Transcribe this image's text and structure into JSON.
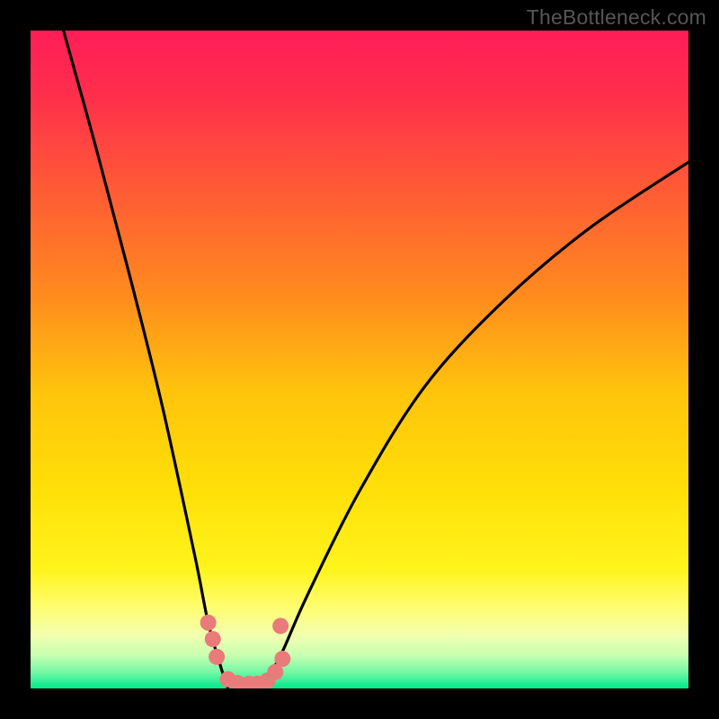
{
  "watermark": "TheBottleneck.com",
  "chart_data": {
    "type": "line",
    "title": "",
    "xlabel": "",
    "ylabel": "",
    "xlim": [
      0,
      100
    ],
    "ylim": [
      0,
      100
    ],
    "background_gradient_stops": [
      {
        "offset": 0.0,
        "color": "#ff1d57"
      },
      {
        "offset": 0.1,
        "color": "#ff2f4b"
      },
      {
        "offset": 0.25,
        "color": "#ff5d34"
      },
      {
        "offset": 0.4,
        "color": "#ff8a1e"
      },
      {
        "offset": 0.55,
        "color": "#ffc40c"
      },
      {
        "offset": 0.7,
        "color": "#ffe008"
      },
      {
        "offset": 0.82,
        "color": "#fff41d"
      },
      {
        "offset": 0.88,
        "color": "#fffd75"
      },
      {
        "offset": 0.92,
        "color": "#f1ffb0"
      },
      {
        "offset": 0.95,
        "color": "#c8ffb0"
      },
      {
        "offset": 0.975,
        "color": "#74f8a6"
      },
      {
        "offset": 1.0,
        "color": "#00e98a"
      }
    ],
    "series": [
      {
        "name": "left-descent",
        "type": "curve",
        "x": [
          5,
          10,
          15,
          20,
          25,
          27,
          29,
          30
        ],
        "y": [
          100,
          82,
          63,
          43,
          20,
          10,
          3,
          0
        ]
      },
      {
        "name": "right-ascent",
        "type": "curve",
        "x": [
          35,
          38,
          42,
          50,
          60,
          72,
          85,
          100
        ],
        "y": [
          0,
          5,
          14,
          30,
          46,
          59,
          70,
          80
        ]
      },
      {
        "name": "markers",
        "type": "scatter",
        "color": "#e97b7b",
        "points": [
          {
            "x": 27.0,
            "y": 10.0
          },
          {
            "x": 27.7,
            "y": 7.5
          },
          {
            "x": 28.3,
            "y": 4.8
          },
          {
            "x": 30.0,
            "y": 1.4
          },
          {
            "x": 31.5,
            "y": 0.8
          },
          {
            "x": 33.2,
            "y": 0.7
          },
          {
            "x": 34.5,
            "y": 0.7
          },
          {
            "x": 36.0,
            "y": 1.2
          },
          {
            "x": 37.2,
            "y": 2.5
          },
          {
            "x": 38.3,
            "y": 4.5
          },
          {
            "x": 38.0,
            "y": 9.5
          }
        ]
      }
    ]
  }
}
